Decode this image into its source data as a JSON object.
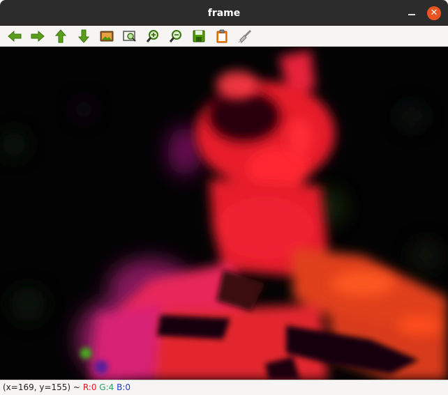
{
  "window": {
    "title": "frame"
  },
  "toolbar": {
    "buttons": [
      {
        "icon": "arrow-left-icon",
        "tooltip": "Pan left"
      },
      {
        "icon": "arrow-right-icon",
        "tooltip": "Pan right"
      },
      {
        "icon": "arrow-up-icon",
        "tooltip": "Pan up"
      },
      {
        "icon": "arrow-down-icon",
        "tooltip": "Pan down"
      },
      {
        "icon": "image-icon",
        "tooltip": "Zoom x1"
      },
      {
        "icon": "zoom-fit-icon",
        "tooltip": "Zoom fit"
      },
      {
        "icon": "zoom-in-icon",
        "tooltip": "Zoom in"
      },
      {
        "icon": "zoom-out-icon",
        "tooltip": "Zoom out"
      },
      {
        "icon": "save-icon",
        "tooltip": "Save"
      },
      {
        "icon": "clipboard-icon",
        "tooltip": "Copy"
      },
      {
        "icon": "brush-icon",
        "tooltip": "Properties"
      }
    ]
  },
  "status": {
    "coords": "(x=169, y=155) ~",
    "r": "R:0",
    "g": "G:4",
    "b": "B:0"
  },
  "colors": {
    "titlebar": "#2c2c2c",
    "close": "#e95420",
    "arrow_green": "#4e9a06",
    "canvas_bg": "#040304"
  }
}
